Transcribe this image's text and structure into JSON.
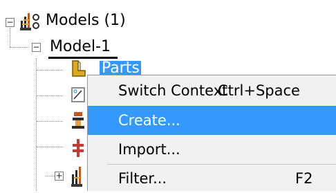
{
  "tree": {
    "models": {
      "label": "Models (1)",
      "expander": "−",
      "icon": "models-icon"
    },
    "model1": {
      "label": "Model-1",
      "expander": "−",
      "underline_color": "#000000"
    },
    "parts": {
      "label": "Parts",
      "icon": "parts-icon",
      "selected_bg": "#3399ff"
    },
    "collapsed_expander": "+"
  },
  "context_menu": {
    "items": [
      {
        "label": "Switch Context",
        "shortcut": "Ctrl+Space",
        "highlighted": false
      },
      {
        "label": "Create...",
        "shortcut": "",
        "highlighted": true
      },
      {
        "label": "Import...",
        "shortcut": "",
        "highlighted": false
      },
      {
        "label": "Filter...",
        "shortcut": "F2",
        "highlighted": false
      }
    ],
    "highlight_color": "#3399ff"
  }
}
